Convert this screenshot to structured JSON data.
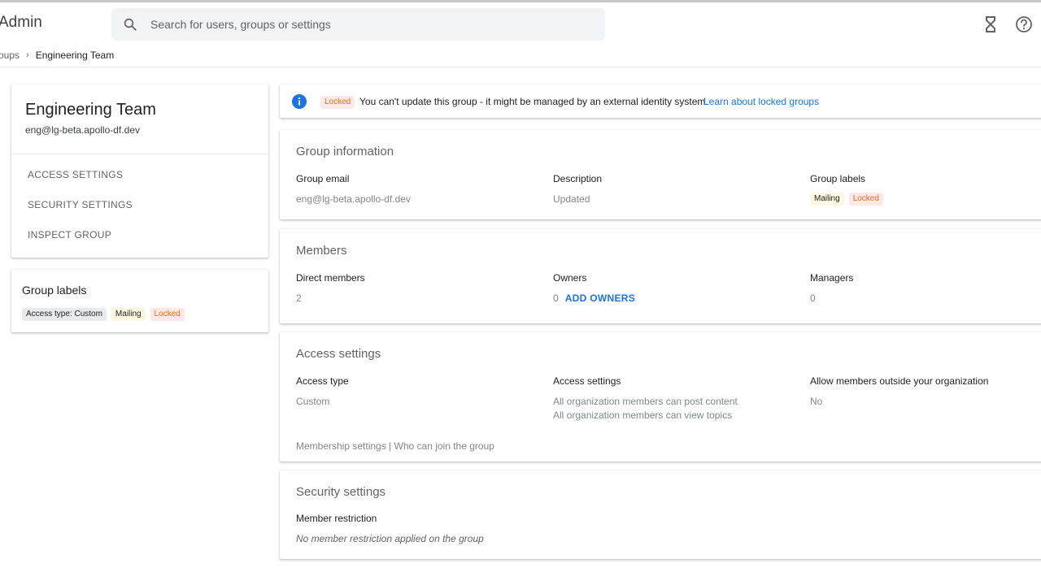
{
  "header": {
    "app_title": "Admin",
    "search_placeholder": "Search for users, groups or settings"
  },
  "breadcrumb": {
    "parent": "roups",
    "separator": "›",
    "current": "Engineering Team"
  },
  "group": {
    "name": "Engineering Team",
    "email": "eng@lg-beta.apollo-df.dev"
  },
  "side_nav": {
    "items": [
      "ACCESS SETTINGS",
      "SECURITY SETTINGS",
      "INSPECT GROUP"
    ]
  },
  "side_labels": {
    "title": "Group labels",
    "chips": [
      "Access type: Custom",
      "Mailing",
      "Locked"
    ]
  },
  "banner": {
    "badge": "Locked",
    "text": "You can't update this group - it might be managed by an external identity system.",
    "link": "Learn about locked groups"
  },
  "group_info": {
    "title": "Group information",
    "email_label": "Group email",
    "email_value": "eng@lg-beta.apollo-df.dev",
    "description_label": "Description",
    "description_value": "Updated",
    "labels_label": "Group labels",
    "labels": [
      "Mailing",
      "Locked"
    ]
  },
  "members": {
    "title": "Members",
    "direct_label": "Direct members",
    "direct_value": "2",
    "owners_label": "Owners",
    "owners_value": "0",
    "add_owners": "ADD OWNERS",
    "managers_label": "Managers",
    "managers_value": "0"
  },
  "access": {
    "title": "Access settings",
    "type_label": "Access type",
    "type_value": "Custom",
    "settings_label": "Access settings",
    "settings_line1": "All organization members can post content",
    "settings_line2": "All organization members can view topics",
    "outside_label": "Allow members outside your organization",
    "outside_value": "No",
    "link_membership": "Membership settings",
    "link_separator": " | ",
    "link_join": "Who can join the group"
  },
  "security": {
    "title": "Security settings",
    "restriction_label": "Member restriction",
    "restriction_value": "No member restriction applied on the group"
  },
  "colors": {
    "accent_blue": "#1a73e8",
    "locked_orange": "#e8710a",
    "locked_bg": "#fce8e6",
    "mailing_bg": "#fef7e0"
  }
}
